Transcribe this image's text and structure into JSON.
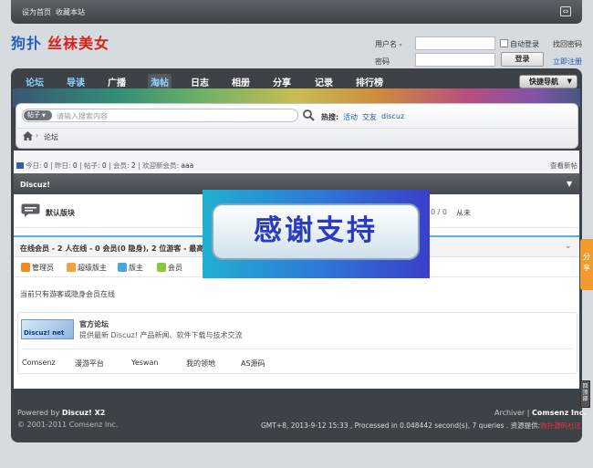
{
  "topbar": {
    "set_home": "设为首页",
    "bookmark": "收藏本站"
  },
  "logo": {
    "part1": "狗扑",
    "part2": "丝袜美女"
  },
  "login": {
    "username_label": "用户名",
    "password_label": "密码",
    "autologin": "自动登录",
    "forgot": "找回密码",
    "login_btn": "登录",
    "register": "立即注册"
  },
  "nav": {
    "items": [
      {
        "label": "论坛"
      },
      {
        "label": "导读"
      },
      {
        "label": "广播"
      },
      {
        "label": "淘帖"
      },
      {
        "label": "日志"
      },
      {
        "label": "相册"
      },
      {
        "label": "分享"
      },
      {
        "label": "记录"
      },
      {
        "label": "排行榜"
      }
    ],
    "quick_nav": "快捷导航"
  },
  "search": {
    "type": "帖子",
    "placeholder": "请输入搜索内容",
    "hot_label": "热搜:",
    "hot": [
      "活动",
      "交友",
      "discuz"
    ]
  },
  "breadcrumb": {
    "current": "论坛"
  },
  "stats": {
    "today_label": "今日:",
    "today": "0",
    "yesterday_label": "昨日:",
    "yesterday": "0",
    "posts_label": "帖子:",
    "posts": "0",
    "members_label": "会员:",
    "members": "2",
    "newest_label": "欢迎新会员:",
    "newest": "aaa",
    "latest_link": "查看新帖"
  },
  "category": {
    "title": "Discuz!"
  },
  "forum": {
    "name": "默认版块",
    "counts": "0 / 0",
    "lastpost": "从未"
  },
  "online": {
    "title": "在线会员 - 2 人在线 - 0 会员(0 隐身), 2 位游客 - 最高记",
    "legend": [
      "管理员",
      "超级版主",
      "版主",
      "会员"
    ],
    "none": "当前只有游客或隐身会员在线"
  },
  "links": {
    "official_logo": "Discuz! net",
    "official_name": "官方论坛",
    "official_desc": "提供最新 Discuz! 产品新闻、软件下载与技术交流",
    "friends": [
      "Comsenz",
      "漫游平台",
      "Yeswan",
      "我的领地",
      "AS源码"
    ]
  },
  "footer": {
    "powered_prefix": "Powered by ",
    "powered_brand": "Discuz! X2",
    "copyright": "© 2001-2011 Comsenz Inc.",
    "archiver": "Archiver",
    "sep": "|",
    "company": "Comsenz Inc.",
    "processed": "GMT+8, 2013-9-12 15:33 , Processed in 0.048442 second(s), 7 queries .",
    "support_label": "资源提供:",
    "support_site": "狗扑源码社区"
  },
  "sidebar_share": "分享",
  "back_top": "回顶部",
  "popup": {
    "text": "感谢支持"
  }
}
